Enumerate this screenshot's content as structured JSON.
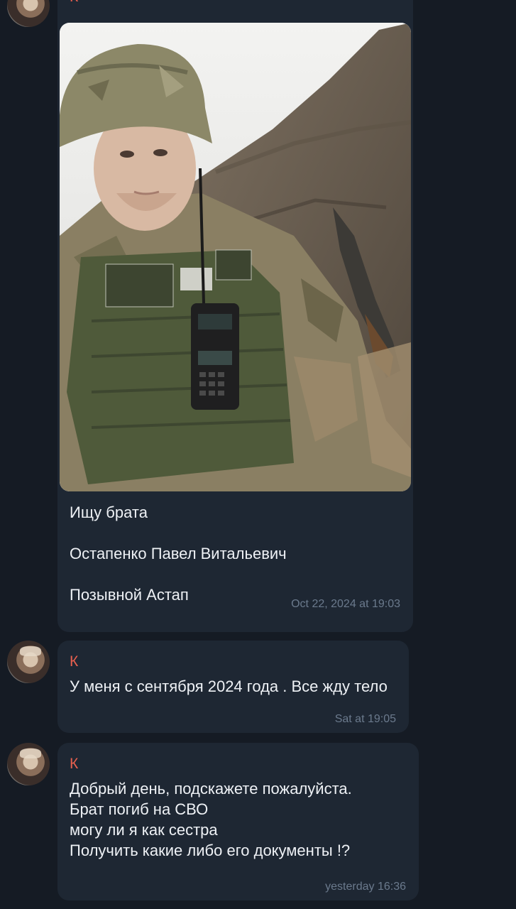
{
  "messages": [
    {
      "sender": "К",
      "photo_alt": "photo",
      "text": "Ищу брата\n\nОстапенко Павел Витальевич\n\nПозывной Астап",
      "time": "Oct 22, 2024 at 19:03"
    },
    {
      "sender": "К",
      "text": "У меня с сентября 2024 года . Все жду тело",
      "time": "Sat at 19:05"
    },
    {
      "sender": "К",
      "text": "Добрый день, подскажете пожалуйста.\nБрат погиб на СВО\nмогу ли я как сестра\nПолучить какие либо его документы !?",
      "time": "yesterday 16:36"
    }
  ],
  "colors": {
    "background": "#151b24",
    "bubble": "#1e2733",
    "sender_name": "#e8604f",
    "timestamp": "#6b7a8d"
  }
}
